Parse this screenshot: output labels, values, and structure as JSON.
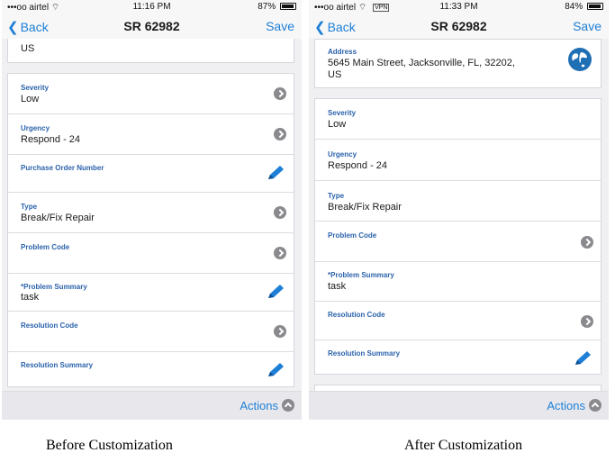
{
  "before": {
    "status": {
      "carrier": "•••oo airtel",
      "time": "11:16 PM",
      "battery": "87%"
    },
    "nav": {
      "back_label": "Back",
      "title": "SR 62982",
      "save_label": "Save"
    },
    "top_card": {
      "value": "US"
    },
    "fields": [
      {
        "label": "Severity",
        "value": "Low",
        "icon": "chevron-right-icon"
      },
      {
        "label": "Urgency",
        "value": "Respond - 24",
        "icon": "chevron-right-icon"
      },
      {
        "label": "Purchase Order Number",
        "value": "",
        "icon": "pencil-icon"
      },
      {
        "label": "Type",
        "value": "Break/Fix Repair",
        "icon": "chevron-right-icon"
      },
      {
        "label": "Problem Code",
        "value": "",
        "icon": "chevron-right-icon"
      },
      {
        "label": "*Problem Summary",
        "value": "task",
        "icon": "pencil-icon"
      },
      {
        "label": "Resolution Code",
        "value": "",
        "icon": "chevron-right-icon"
      },
      {
        "label": "Resolution Summary",
        "value": "",
        "icon": "pencil-icon"
      }
    ],
    "actions_label": "Actions"
  },
  "after": {
    "status": {
      "carrier": "•••oo airtel",
      "vpn": "VPN",
      "time": "11:33 PM",
      "battery": "84%"
    },
    "nav": {
      "back_label": "Back",
      "title": "SR 62982",
      "save_label": "Save"
    },
    "address": {
      "label": "Address",
      "line1": "5645 Main Street, Jacksonville, FL, 32202,",
      "line2": "US",
      "icon": "globe-icon"
    },
    "fields": [
      {
        "label": "Severity",
        "value": "Low",
        "icon": "none"
      },
      {
        "label": "Urgency",
        "value": "Respond - 24",
        "icon": "none"
      },
      {
        "label": "Type",
        "value": "Break/Fix Repair",
        "icon": "none"
      },
      {
        "label": "Problem Code",
        "value": "",
        "icon": "chevron-right-icon"
      },
      {
        "label": "*Problem Summary",
        "value": "task",
        "icon": "none"
      },
      {
        "label": "Resolution Code",
        "value": "",
        "icon": "chevron-right-icon"
      },
      {
        "label": "Resolution Summary",
        "value": "",
        "icon": "pencil-icon"
      }
    ],
    "actions_label": "Actions"
  },
  "captions": {
    "before": "Before Customization",
    "after": "After Customization"
  },
  "colors": {
    "accent": "#1e7fd6",
    "label_blue": "#2b62ab",
    "globe": "#1f6fb5",
    "chevron_gray": "#8a8a8e"
  }
}
